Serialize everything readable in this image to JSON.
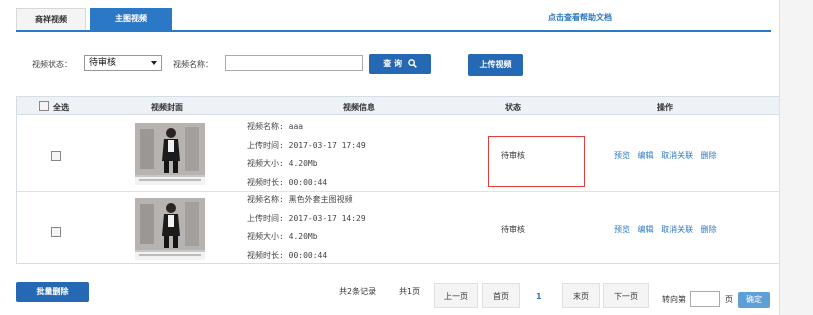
{
  "tabs": [
    {
      "label": "商祥视频",
      "active": false
    },
    {
      "label": "主图视频",
      "active": true
    }
  ],
  "help_link": "点击查看帮助文档",
  "filter": {
    "status_label": "视频状态：",
    "status_value": "待审核",
    "name_label": "视频名称：",
    "name_value": "",
    "search_label": "查 询",
    "upload_label": "上传视频"
  },
  "table": {
    "headers": {
      "select_all": "全选",
      "cover": "视频封面",
      "info": "视频信息",
      "status": "状态",
      "ops": "操作"
    },
    "rows": [
      {
        "name": "视频名称: aaa",
        "upload_time": "上传时间: 2017-03-17 17:49",
        "size": "视频大小: 4.20Mb",
        "duration": "视频时长: 00:00:44",
        "status": "待审核",
        "ops": [
          "预览",
          "编辑",
          "取消关联",
          "删除"
        ]
      },
      {
        "name": "视频名称: 黑色外套主图视频",
        "upload_time": "上传时间: 2017-03-17 14:29",
        "size": "视频大小: 4.20Mb",
        "duration": "视频时长: 00:00:44",
        "status": "待审核",
        "ops": [
          "预览",
          "编辑",
          "取消关联",
          "删除"
        ]
      }
    ]
  },
  "batch_delete": "批量删除",
  "pagination": {
    "total_records": "共2条记录",
    "total_pages": "共1页",
    "prev": "上一页",
    "first": "首页",
    "current": "1",
    "last": "末页",
    "next": "下一页",
    "goto_label": "转向第",
    "page_unit": "页",
    "confirm": "确定"
  },
  "colors": {
    "accent": "#2b78c6",
    "button": "#2569b4",
    "highlight_box": "#e23c3c"
  }
}
